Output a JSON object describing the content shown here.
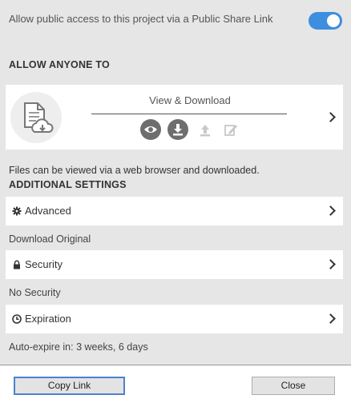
{
  "share_toggle": {
    "label": "Allow public access to this project via a Public Share Link",
    "enabled": true,
    "accent_color": "#3d8ede"
  },
  "allow_section": {
    "heading": "ALLOW ANYONE TO",
    "permission": {
      "title": "View & Download",
      "icons": [
        {
          "name": "view-icon",
          "active": true
        },
        {
          "name": "download-icon",
          "active": true
        },
        {
          "name": "upload-icon",
          "active": false
        },
        {
          "name": "edit-icon",
          "active": false
        }
      ]
    },
    "description": "Files can be viewed via a web browser and downloaded."
  },
  "additional_settings": {
    "heading": "ADDITIONAL SETTINGS",
    "rows": [
      {
        "icon": "gear-icon",
        "label": "Advanced",
        "value": "Download Original"
      },
      {
        "icon": "lock-icon",
        "label": "Security",
        "value": "No Security"
      },
      {
        "icon": "clock-icon",
        "label": "Expiration",
        "value": "Auto-expire in: 3 weeks, 6 days"
      }
    ]
  },
  "footer": {
    "copy_label": "Copy Link",
    "close_label": "Close"
  }
}
